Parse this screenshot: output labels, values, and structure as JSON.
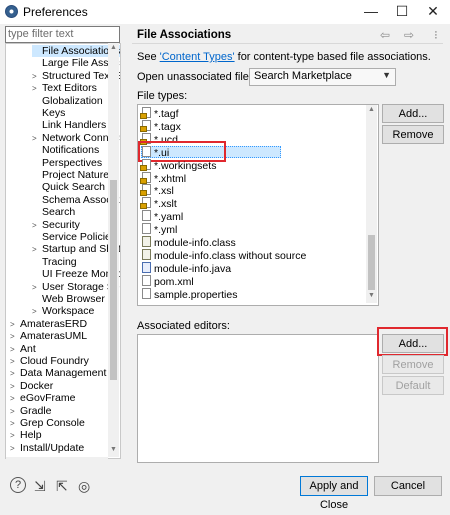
{
  "window": {
    "title": "Preferences",
    "controls": {
      "minimize": "—",
      "maximize": "☐",
      "close": "✕"
    }
  },
  "filter": {
    "placeholder": "type filter text"
  },
  "tree": [
    {
      "label": "File Associations",
      "arrow": "",
      "selected": true
    },
    {
      "label": "Large File Associa",
      "arrow": ""
    },
    {
      "label": "Structured Text Ed",
      "arrow": ">"
    },
    {
      "label": "Text Editors",
      "arrow": ">"
    },
    {
      "label": "Globalization",
      "arrow": ""
    },
    {
      "label": "Keys",
      "arrow": ""
    },
    {
      "label": "Link Handlers",
      "arrow": ""
    },
    {
      "label": "Network Connection",
      "arrow": ">"
    },
    {
      "label": "Notifications",
      "arrow": ""
    },
    {
      "label": "Perspectives",
      "arrow": ""
    },
    {
      "label": "Project Natures",
      "arrow": ""
    },
    {
      "label": "Quick Search",
      "arrow": ""
    },
    {
      "label": "Schema Associations",
      "arrow": ""
    },
    {
      "label": "Search",
      "arrow": ""
    },
    {
      "label": "Security",
      "arrow": ">"
    },
    {
      "label": "Service Policies",
      "arrow": ""
    },
    {
      "label": "Startup and Shutdow",
      "arrow": ">"
    },
    {
      "label": "Tracing",
      "arrow": ""
    },
    {
      "label": "UI Freeze Monitoring",
      "arrow": ""
    },
    {
      "label": "User Storage Service",
      "arrow": ">"
    },
    {
      "label": "Web Browser",
      "arrow": ""
    },
    {
      "label": "Workspace",
      "arrow": ">"
    },
    {
      "label": "AmaterasERD",
      "arrow": ">"
    },
    {
      "label": "AmaterasUML",
      "arrow": ">"
    },
    {
      "label": "Ant",
      "arrow": ">"
    },
    {
      "label": "Cloud Foundry",
      "arrow": ">"
    },
    {
      "label": "Data Management",
      "arrow": ">"
    },
    {
      "label": "Docker",
      "arrow": ">"
    },
    {
      "label": "eGovFrame",
      "arrow": ">"
    },
    {
      "label": "Gradle",
      "arrow": ">"
    },
    {
      "label": "Grep Console",
      "arrow": ">"
    },
    {
      "label": "Help",
      "arrow": ">"
    },
    {
      "label": "Install/Update",
      "arrow": ">"
    }
  ],
  "page": {
    "title": "File Associations",
    "nav": {
      "back": "⇦",
      "forward": "⇨",
      "menu": "⁝"
    },
    "see_prefix": "See ",
    "see_link": "'Content Types'",
    "see_suffix": " for content-type based file associations.",
    "open_label": "Open unassociated files with:",
    "open_value": "Search Marketplace",
    "file_types_label": "File types:",
    "associated_label": "Associated editors:"
  },
  "file_types": [
    {
      "name": "*.tagf",
      "icon": "lock"
    },
    {
      "name": "*.tagx",
      "icon": "lock"
    },
    {
      "name": "*.ucd",
      "icon": "lock"
    },
    {
      "name": "*.ui",
      "icon": "file",
      "selected": true
    },
    {
      "name": "*.workingsets",
      "icon": "lock"
    },
    {
      "name": "*.xhtml",
      "icon": "lock"
    },
    {
      "name": "*.xsl",
      "icon": "lock"
    },
    {
      "name": "*.xslt",
      "icon": "lock"
    },
    {
      "name": "*.yaml",
      "icon": "file"
    },
    {
      "name": "*.yml",
      "icon": "file"
    },
    {
      "name": "module-info.class",
      "icon": "cls"
    },
    {
      "name": "module-info.class without source",
      "icon": "cls"
    },
    {
      "name": "module-info.java",
      "icon": "java"
    },
    {
      "name": "pom.xml",
      "icon": "file"
    },
    {
      "name": "sample.properties",
      "icon": "file"
    }
  ],
  "buttons": {
    "add_type": "Add...",
    "remove_type": "Remove",
    "add_editor": "Add...",
    "remove_editor": "Remove",
    "default_editor": "Default",
    "apply_close": "Apply and Close",
    "cancel": "Cancel"
  },
  "bottom_icons": {
    "help": "?",
    "import": "⇲",
    "export": "⇱",
    "settings": "◎"
  }
}
